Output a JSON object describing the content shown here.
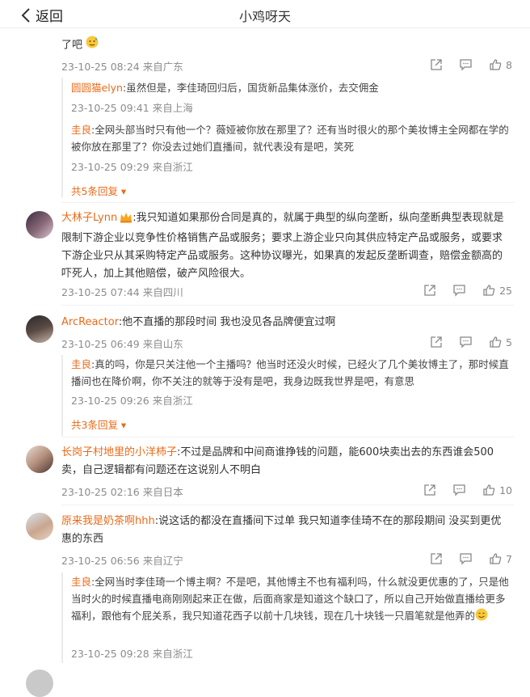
{
  "header": {
    "back_label": "返回",
    "title": "小鸡呀天"
  },
  "top_fragment": {
    "text_cut": "了吧",
    "meta": "23-10-25 08:24 来自广东",
    "likes": "8"
  },
  "reply_group_1": {
    "replies": [
      {
        "name": "圆圆猫elyn",
        "text": ":虽然但是，李佳琦回归后，国货新品集体涨价，去交佣金",
        "meta": "23-10-25 09:41 来自上海"
      },
      {
        "name": "圭良",
        "text": ":全网头部当时只有他一个？薇娅被你放在那里了？还有当时很火的那个美妆博主全网都在学的被你放在那里了？你没去过她们直播间，就代表没有是吧，笑死",
        "meta": "23-10-25 09:29 来自浙江"
      }
    ],
    "more": "共5条回复"
  },
  "comments": [
    {
      "name": "大林子Lynn",
      "text": ":我只知道如果那份合同是真的，就属于典型的纵向垄断，纵向垄断典型表现就是限制下游企业以竞争性价格销售产品或服务；要求上游企业只向其供应特定产品或服务，或要求下游企业只从其采购特定产品或服务。这种协议曝光，如果真的发起反垄断调查，赔偿金额高的吓死人，加上其他赔偿，破产风险很大。",
      "meta": "23-10-25 07:44 来自四川",
      "likes": "25"
    },
    {
      "name": "ArcReactor",
      "text": ":他不直播的那段时间 我也没见各品牌便宜过啊",
      "meta": "23-10-25 06:49 来自山东",
      "likes": "5"
    },
    {
      "name": "长岗子村地里的小洋柿子",
      "text": ":不过是品牌和中间商谁挣钱的问题，能600块卖出去的东西谁会500卖，自己逻辑都有问题还在这说别人不明白",
      "meta": "23-10-25 02:16 来自日本",
      "likes": "10"
    },
    {
      "name": "原来我是奶茶啊hhh",
      "text": ":说这话的都没在直播间下过单 我只知道李佳琦不在的那段期间 没买到更优惠的东西",
      "meta": "23-10-25 06:56 来自辽宁",
      "likes": "7"
    }
  ],
  "reply_group_2": {
    "reply": {
      "name": "圭良",
      "text": ":真的吗，你是只关注他一个主播吗？他当时还没火时候，已经火了几个美妆博主了，那时候直播间也在降价啊，你不关注的就等于没有是吧，我身边既我世界是吧，有意思",
      "meta": "23-10-25 09:26 来自浙江"
    },
    "more": "共3条回复"
  },
  "reply_group_3": {
    "reply": {
      "name": "圭良",
      "text": ":全网当时李佳琦一个博主啊？不是吧，其他博主不也有福利吗，什么就没更优惠的了，只是他当时火的时候直播电商刚刚起来正在做，后面商家是知道这个缺口了，所以自己开始做直播给更多福利，跟他有个屁关系，我只知道花西子以前十几块钱，现在几十块钱一只眉笔就是他弄的",
      "meta": "23-10-25 09:28 来自浙江"
    }
  },
  "colors": {
    "name": "#e86b1a",
    "meta": "#8c8c8c",
    "text": "#333333"
  },
  "icons": [
    "chevron-left-icon",
    "share-icon",
    "comment-icon",
    "like-icon",
    "expand-arrow-icon",
    "emoji-sweat-icon",
    "crown-badge-icon",
    "emoji-smile-icon"
  ]
}
